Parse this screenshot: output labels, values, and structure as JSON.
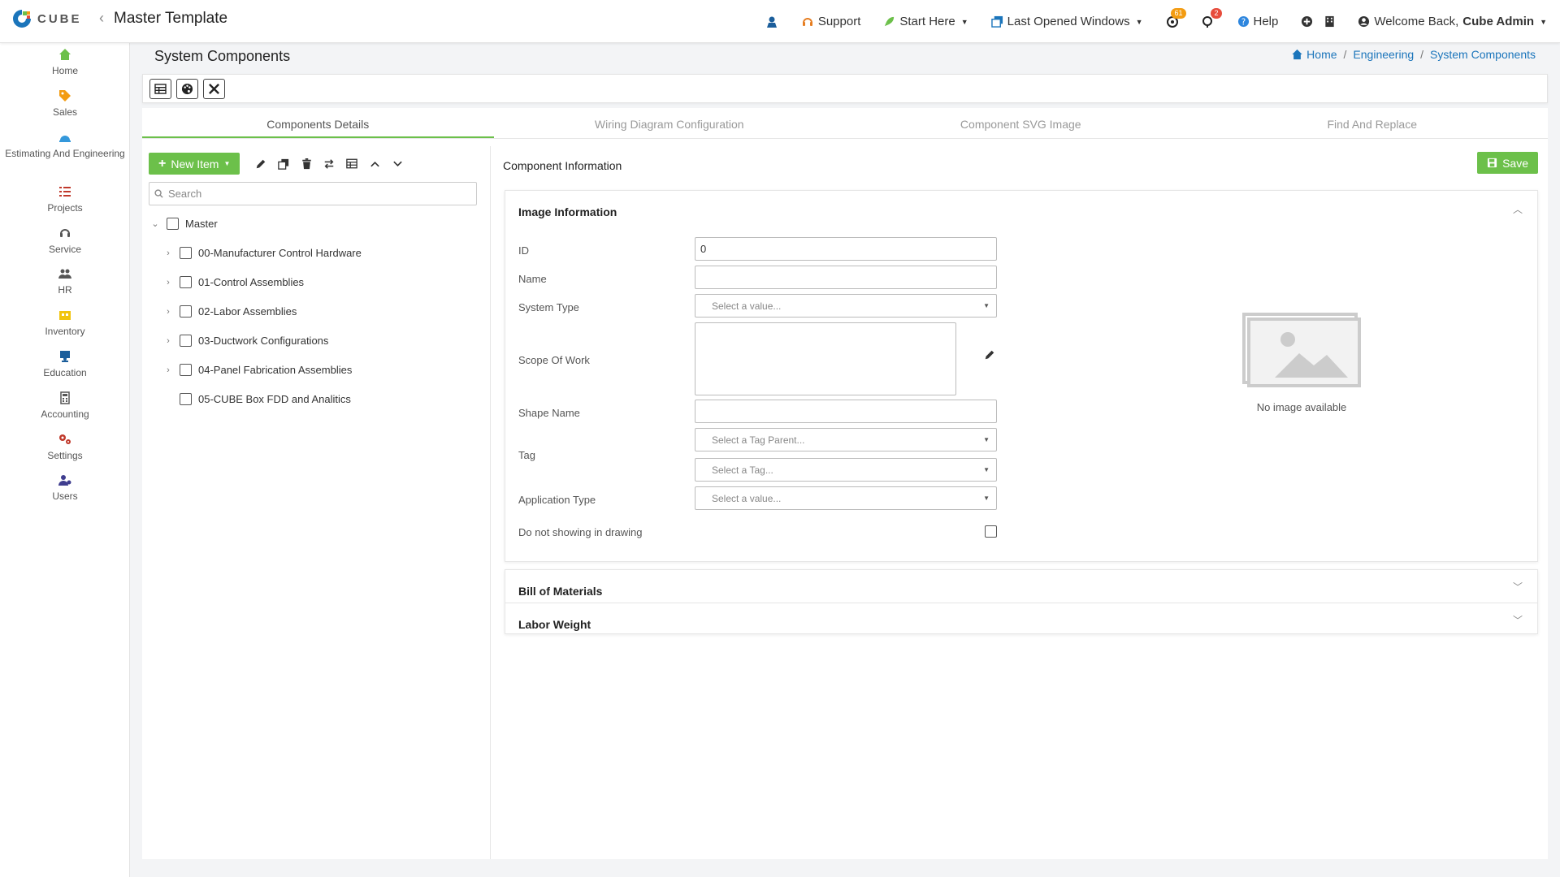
{
  "app": {
    "logo_text": "CUBE",
    "page_title": "Master Template",
    "colors": {
      "accent": "#6cc04a",
      "link": "#1b75bb",
      "badge_orange": "#f39c12",
      "badge_red": "#e74c3c"
    }
  },
  "topnav": {
    "support": "Support",
    "start_here": "Start Here",
    "last_opened": "Last Opened Windows",
    "notif_badge_1": "61",
    "notif_badge_2": "2",
    "help": "Help",
    "welcome_prefix": "Welcome Back,",
    "welcome_user": "Cube Admin"
  },
  "sidebar": {
    "items": [
      {
        "label": "Home",
        "icon": "home-icon",
        "color": "#6cc04a"
      },
      {
        "label": "Sales",
        "icon": "tag-icon",
        "color": "#f39c12"
      },
      {
        "label": "Estimating And Engineering",
        "icon": "hardhat-icon",
        "color": "#3498db"
      },
      {
        "label": "Projects",
        "icon": "tasks-icon",
        "color": "#c0392b"
      },
      {
        "label": "Service",
        "icon": "headset-icon",
        "color": "#555555"
      },
      {
        "label": "HR",
        "icon": "people-icon",
        "color": "#555555"
      },
      {
        "label": "Inventory",
        "icon": "warehouse-icon",
        "color": "#f1c40f"
      },
      {
        "label": "Education",
        "icon": "teacher-icon",
        "color": "#1b5e9b"
      },
      {
        "label": "Accounting",
        "icon": "calculator-icon",
        "color": "#555555"
      },
      {
        "label": "Settings",
        "icon": "gears-icon",
        "color": "#c0392b"
      },
      {
        "label": "Users",
        "icon": "users-cog-icon",
        "color": "#3f3d8f"
      }
    ]
  },
  "main": {
    "section_title": "System Components",
    "breadcrumb": [
      "Home",
      "Engineering",
      "System Components"
    ],
    "tabs": [
      {
        "label": "Components Details",
        "active": true
      },
      {
        "label": "Wiring Diagram Configuration",
        "active": false
      },
      {
        "label": "Component SVG Image",
        "active": false
      },
      {
        "label": "Find And Replace",
        "active": false
      }
    ]
  },
  "tree": {
    "new_item_label": "New Item",
    "search_placeholder": "Search",
    "root": "Master",
    "children": [
      {
        "label": "00-Manufacturer Control Hardware",
        "expandable": true
      },
      {
        "label": "01-Control Assemblies",
        "expandable": true
      },
      {
        "label": "02-Labor Assemblies",
        "expandable": true
      },
      {
        "label": "03-Ductwork Configurations",
        "expandable": true
      },
      {
        "label": "04-Panel Fabrication Assemblies",
        "expandable": true
      },
      {
        "label": "05-CUBE Box FDD and Analitics",
        "expandable": false
      }
    ]
  },
  "form": {
    "title": "Component Information",
    "save_label": "Save",
    "image_info": {
      "heading": "Image Information",
      "id_label": "ID",
      "id_value": "0",
      "name_label": "Name",
      "system_type_label": "System Type",
      "system_type_placeholder": "Select a value...",
      "scope_label": "Scope Of Work",
      "shape_label": "Shape Name",
      "tag_label": "Tag",
      "tag_parent_placeholder": "Select a Tag Parent...",
      "tag_placeholder": "Select a Tag...",
      "app_type_label": "Application Type",
      "app_type_placeholder": "Select a value...",
      "no_drawing_label": "Do not showing in drawing",
      "no_image_text": "No image available"
    },
    "bom_heading": "Bill of Materials",
    "labor_heading": "Labor Weight"
  }
}
